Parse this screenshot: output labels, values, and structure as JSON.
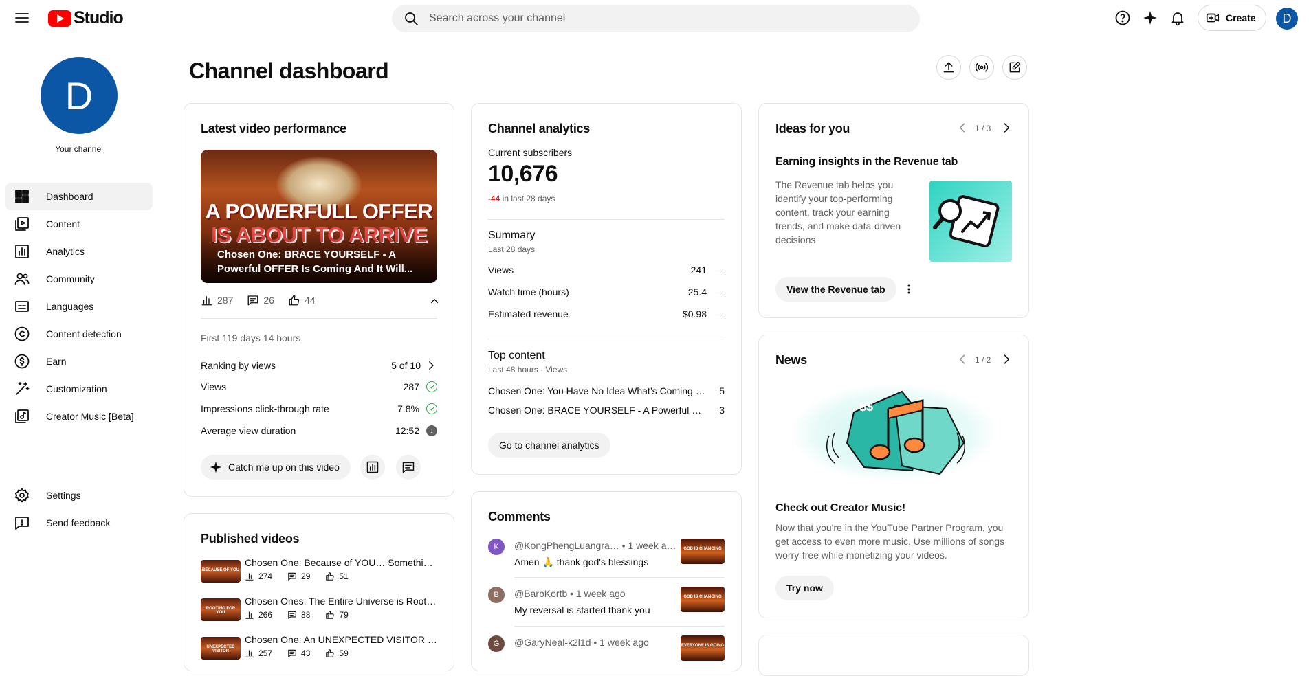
{
  "header": {
    "logo_text": "Studio",
    "search_placeholder": "Search across your channel",
    "create_label": "Create",
    "avatar_letter": "D"
  },
  "sidebar": {
    "avatar_letter": "D",
    "your_channel": "Your channel",
    "items": [
      {
        "label": "Dashboard",
        "icon": "dashboard-icon",
        "active": true
      },
      {
        "label": "Content",
        "icon": "content-icon"
      },
      {
        "label": "Analytics",
        "icon": "analytics-icon"
      },
      {
        "label": "Community",
        "icon": "community-icon"
      },
      {
        "label": "Languages",
        "icon": "languages-icon"
      },
      {
        "label": "Content detection",
        "icon": "copyright-icon"
      },
      {
        "label": "Earn",
        "icon": "earn-icon"
      },
      {
        "label": "Customization",
        "icon": "customization-icon"
      },
      {
        "label": "Creator Music [Beta]",
        "icon": "music-icon"
      }
    ],
    "bottom": [
      {
        "label": "Settings",
        "icon": "settings-icon"
      },
      {
        "label": "Send feedback",
        "icon": "feedback-icon"
      }
    ]
  },
  "page": {
    "title": "Channel dashboard"
  },
  "latest": {
    "title": "Latest video performance",
    "thumb_line1": "A POWERFULL OFFER",
    "thumb_line2": "IS ABOUT TO ARRIVE",
    "caption": "Chosen One: BRACE YOURSELF - A Powerful OFFER Is Coming And It Will...",
    "views": "287",
    "comments": "26",
    "likes": "44",
    "period": "First 119 days 14 hours",
    "ranking_label": "Ranking by views",
    "ranking_value": "5 of 10",
    "views_label": "Views",
    "views_value": "287",
    "ctr_label": "Impressions click-through rate",
    "ctr_value": "7.8%",
    "avd_label": "Average view duration",
    "avd_value": "12:52",
    "catch_me_up": "Catch me up on this video"
  },
  "published": {
    "title": "Published videos",
    "items": [
      {
        "title": "Chosen One: Because of YOU… Something …",
        "views": "274",
        "comments": "29",
        "likes": "51",
        "thumb": "BECAUSE OF YOU"
      },
      {
        "title": "Chosen Ones: The Entire Universe is Rootin…",
        "views": "266",
        "comments": "88",
        "likes": "79",
        "thumb": "ROOTING FOR YOU"
      },
      {
        "title": "Chosen One: An UNEXPECTED VISITOR Is …",
        "views": "257",
        "comments": "43",
        "likes": "59",
        "thumb": "UNEXPECTED VISITOR"
      }
    ]
  },
  "analytics": {
    "title": "Channel analytics",
    "subs_label": "Current subscribers",
    "subs_value": "10,676",
    "subs_change": "-44",
    "subs_change_suffix": " in last 28 days",
    "summary_title": "Summary",
    "summary_period": "Last 28 days",
    "rows": [
      {
        "label": "Views",
        "value": "241",
        "trend": "—"
      },
      {
        "label": "Watch time (hours)",
        "value": "25.4",
        "trend": "—"
      },
      {
        "label": "Estimated revenue",
        "value": "$0.98",
        "trend": "—"
      }
    ],
    "top_title": "Top content",
    "top_period": "Last 48 hours · Views",
    "top": [
      {
        "title": "Chosen One: You Have No Idea What’s Coming Nex…",
        "value": "5"
      },
      {
        "title": "Chosen One: BRACE YOURSELF - A Powerful OFFE…",
        "value": "3"
      }
    ],
    "go_button": "Go to channel analytics"
  },
  "comments": {
    "title": "Comments",
    "items": [
      {
        "avatar": "K",
        "avatar_color": "#7e57c2",
        "author": "@KongPhengLuangra…",
        "time": "• 1 week a…",
        "text": "Amen 🙏 thank god's blessings",
        "thumb": "GOD IS CHANGING"
      },
      {
        "avatar": "B",
        "avatar_color": "#8d6e63",
        "author": "@BarbKortb",
        "time": "• 1 week ago",
        "text": "My reversal is started thank you",
        "thumb": "GOD IS CHANGING"
      },
      {
        "avatar": "G",
        "avatar_color": "#6d4c41",
        "author": "@GaryNeal-k2l1d",
        "time": "• 1 week ago",
        "text": "",
        "thumb": "EVERYONE IS GOING"
      }
    ]
  },
  "ideas": {
    "title": "Ideas for you",
    "pager": "1 / 3",
    "subtitle": "Earning insights in the Revenue tab",
    "text": "The Revenue tab helps you identify your top-performing content, track your earning trends, and make data-driven decisions",
    "button": "View the Revenue tab"
  },
  "news": {
    "title": "News",
    "pager": "1 / 2",
    "subtitle": "Check out Creator Music!",
    "text": "Now that you're in the YouTube Partner Program, you get access to even more music. Use millions of songs worry-free while monetizing your videos.",
    "button": "Try now"
  }
}
